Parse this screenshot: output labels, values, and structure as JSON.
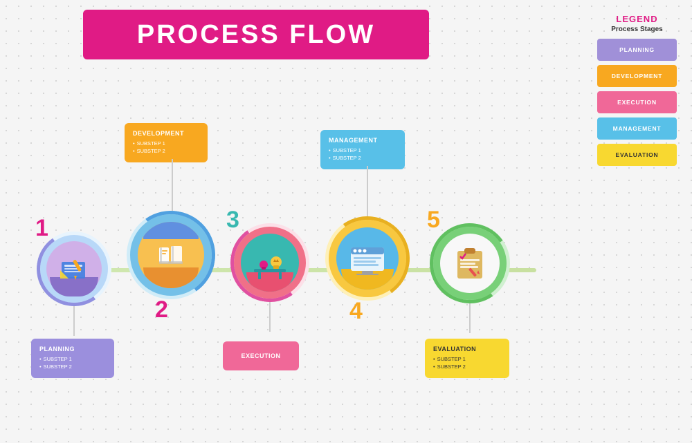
{
  "title": "PROCESS FLOW",
  "legend": {
    "title": "LEGEND",
    "subtitle": "Process Stages",
    "items": [
      {
        "label": "PLANNING",
        "color": "#a090d8"
      },
      {
        "label": "DEVELOPMENT",
        "color": "#f8a820"
      },
      {
        "label": "EXECUTION",
        "color": "#f06898"
      },
      {
        "label": "MANAGEMENT",
        "color": "#58c0e8"
      },
      {
        "label": "EVALUATION",
        "color": "#f8d830"
      }
    ]
  },
  "stages": [
    {
      "number": "1",
      "label": "PLANNING",
      "box_position": "bottom",
      "box_color": "#9b8fdd",
      "substeps": [
        "SUBSTEP 1",
        "SUBSTEP 2"
      ]
    },
    {
      "number": "2",
      "label": "DEVELOPMENT",
      "box_position": "top",
      "box_color": "#f8a820",
      "substeps": [
        "SUBSTEP 1",
        "SUBSTEP 2"
      ]
    },
    {
      "number": "3",
      "label": "EXECUTION",
      "box_position": "bottom",
      "box_color": "#f06898",
      "substeps": []
    },
    {
      "number": "4",
      "label": "MANAGEMENT",
      "box_position": "top",
      "box_color": "#58c0e8",
      "substeps": [
        "SUBSTEP 1",
        "SUBSTEP 2"
      ]
    },
    {
      "number": "5",
      "label": "EVALUATION",
      "box_position": "bottom",
      "box_color": "#f8d830",
      "substeps": [
        "SUBSTEP 1",
        "SUBSTEP 2"
      ]
    }
  ]
}
